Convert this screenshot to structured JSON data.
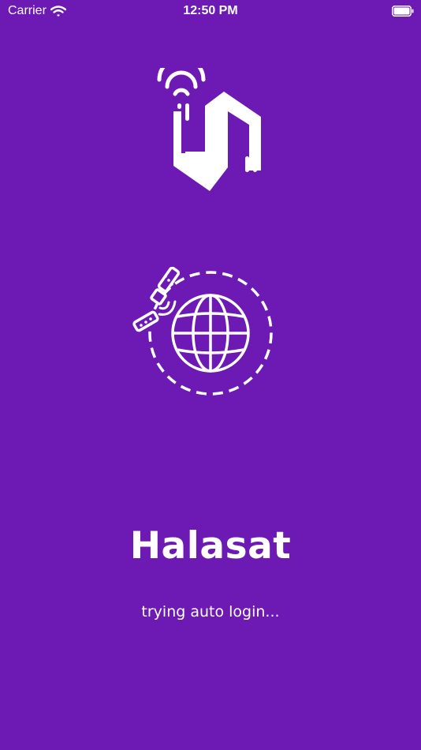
{
  "status_bar": {
    "carrier": "Carrier",
    "time": "12:50 PM",
    "icons": [
      "wifi-icon",
      "battery-icon"
    ]
  },
  "splash": {
    "app_name": "Halasat",
    "message": "trying auto login...",
    "logo_icon": "halasat-logo-icon",
    "illustration_icon": "satellite-globe-icon"
  },
  "colors": {
    "background": "#6c1ab3",
    "foreground": "#ffffff"
  }
}
